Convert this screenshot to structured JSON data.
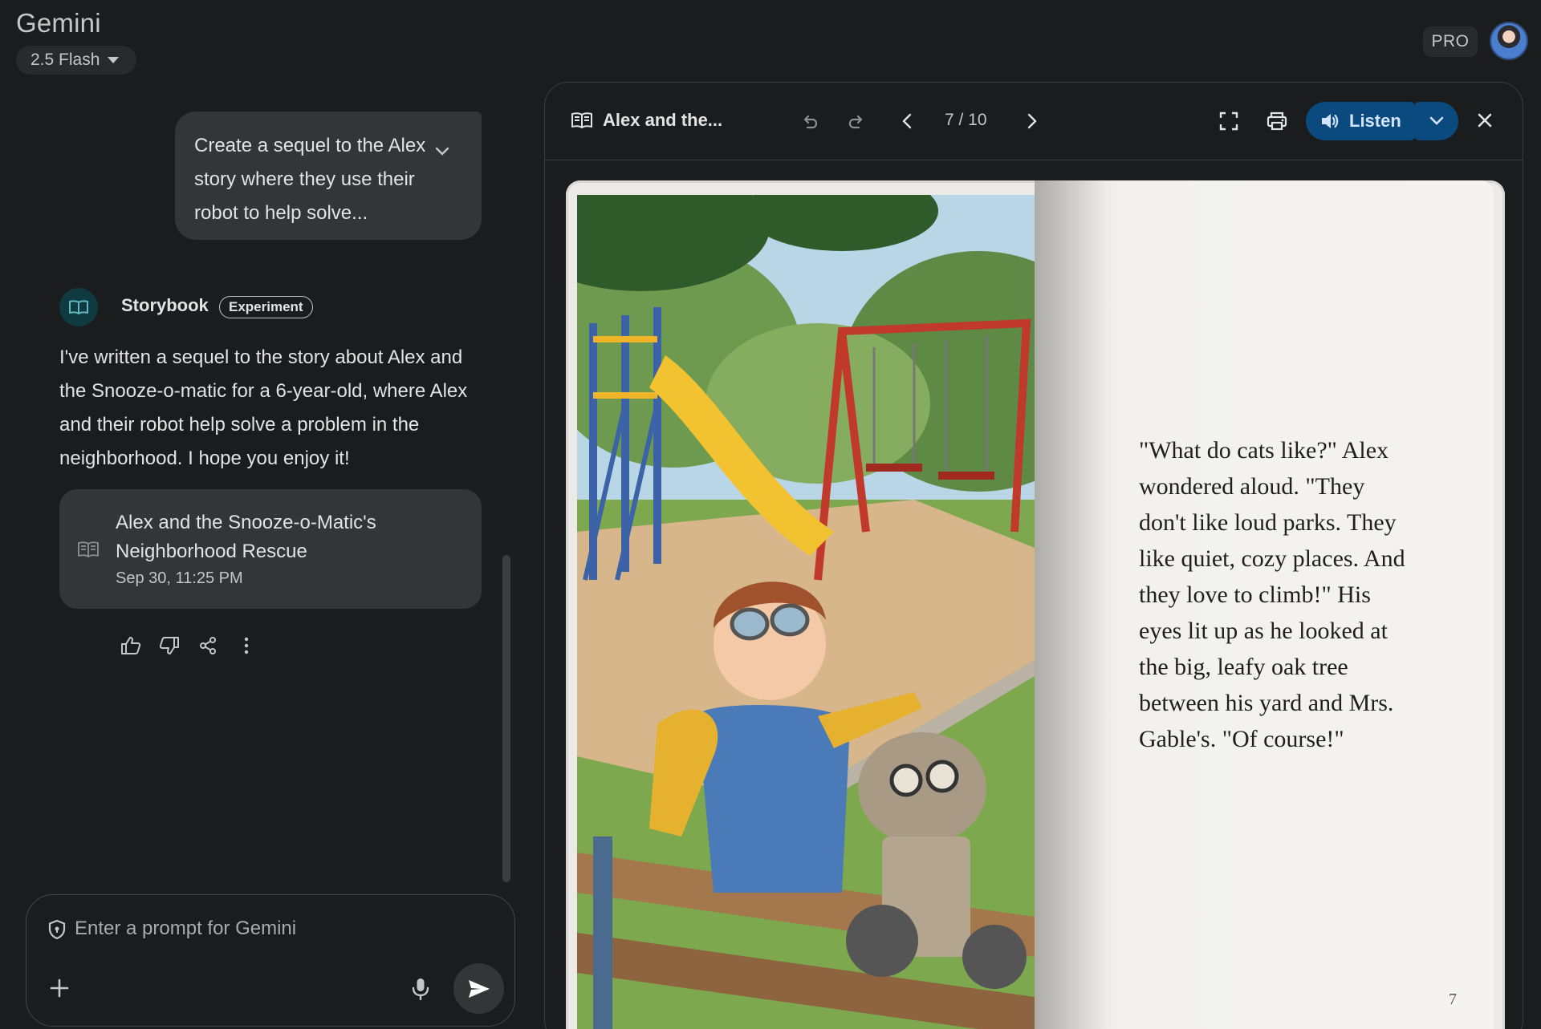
{
  "header": {
    "app_title": "Gemini",
    "model_label": "2.5 Flash",
    "pro_badge": "PRO"
  },
  "chat": {
    "user_prompt": "Create a sequel to the Alex story where they use their robot to help solve...",
    "agent_name": "Storybook",
    "agent_badge": "Experiment",
    "response_text": "I've written a sequel to the story about Alex and the Snooze-o-matic for a 6-year-old, where Alex and their robot help solve a problem in the neighborhood. I hope you enjoy it!",
    "story_card": {
      "title": "Alex and the Snooze-o-Matic's Neighborhood Rescue",
      "date": "Sep 30, 11:25 PM"
    }
  },
  "prompt": {
    "placeholder": "Enter a prompt for Gemini"
  },
  "reader": {
    "title": "Alex and the...",
    "page_indicator": "7 / 10",
    "listen_label": "Listen",
    "page_text": "\"What do cats like?\" Alex wondered aloud. \"They don't like loud parks. They like quiet, cozy places. And they love to climb!\" His eyes lit up as he looked at the big, leafy oak tree between his yard and Mrs. Gable's. \"Of course!\"",
    "page_number": "7"
  },
  "colors": {
    "background": "#1b1c1d",
    "surface": "#333537",
    "accent_button": "#0b4a7e",
    "accent_text": "#d3e3fd"
  }
}
